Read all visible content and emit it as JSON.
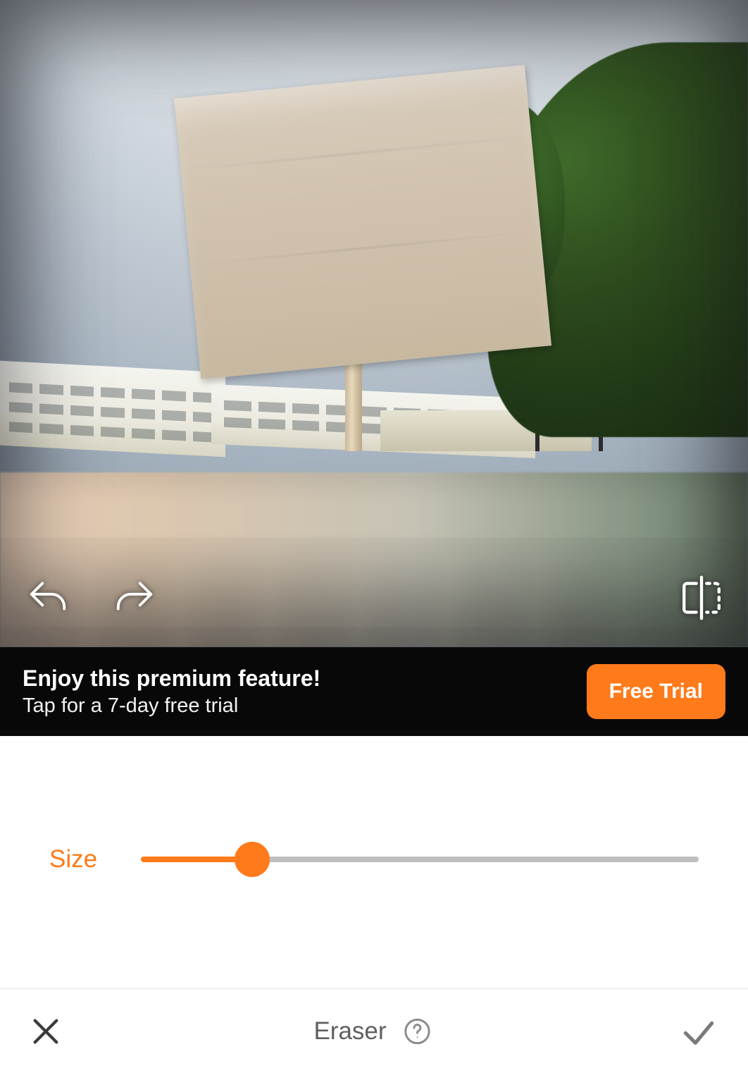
{
  "theme": {
    "accent": "#ff7a1a"
  },
  "canvas": {
    "undo_label": "Undo",
    "redo_label": "Redo",
    "compare_label": "Compare before/after"
  },
  "banner": {
    "title": "Enjoy this premium feature!",
    "subtitle": "Tap for a 7-day free trial",
    "cta_label": "Free Trial"
  },
  "slider": {
    "label": "Size",
    "value_percent": 20
  },
  "bottombar": {
    "tool_name": "Eraser",
    "close_label": "Close",
    "confirm_label": "Apply",
    "help_label": "Help"
  }
}
